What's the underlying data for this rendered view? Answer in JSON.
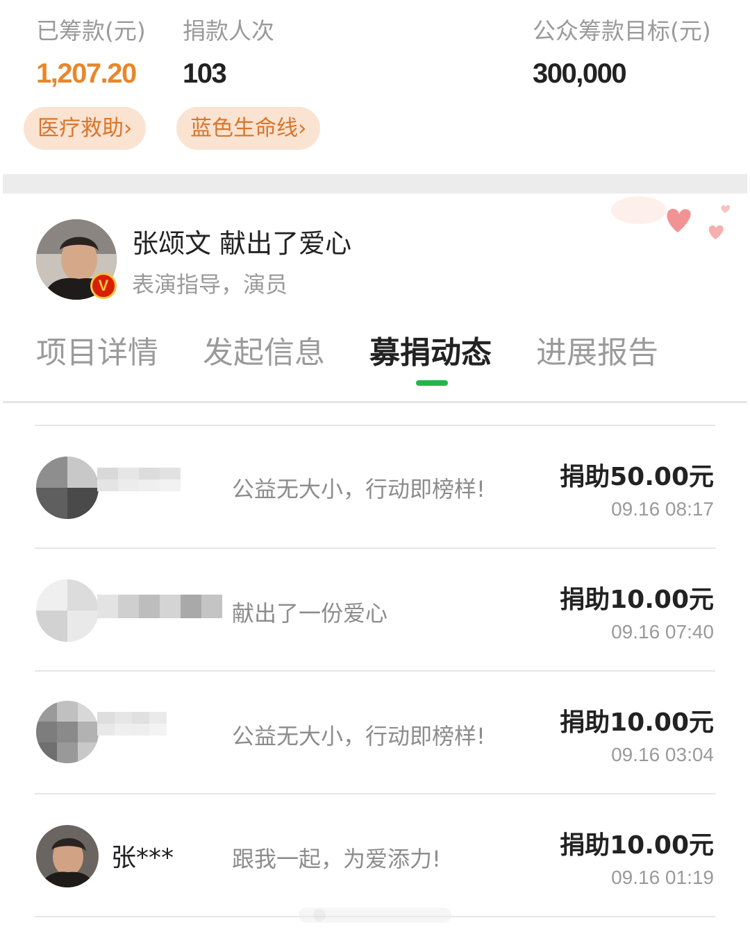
{
  "stats": {
    "raised_label": "已筹款(元)",
    "raised_value": "1,207.20",
    "donations_label": "捐款人次",
    "donations_value": "103",
    "goal_label": "公众筹款目标(元)",
    "goal_value": "300,000"
  },
  "tags": [
    {
      "label": "医疗救助›"
    },
    {
      "label": "蓝色生命线›"
    }
  ],
  "featured_donor": {
    "title": "张颂文 献出了爱心",
    "subtitle": "表演指导，演员",
    "badge": "V"
  },
  "tabs": [
    {
      "label": "项目详情"
    },
    {
      "label": "发起信息"
    },
    {
      "label": "募捐动态"
    },
    {
      "label": "进展报告"
    }
  ],
  "active_tab": "募捐动态",
  "donations": [
    {
      "name": "",
      "message": "公益无大小，行动即榜样!",
      "amount": "捐助50.00元",
      "time": "09.16 08:17"
    },
    {
      "name": "",
      "message": "献出了一份爱心",
      "amount": "捐助10.00元",
      "time": "09.16 07:40"
    },
    {
      "name": "",
      "message": "公益无大小，行动即榜样!",
      "amount": "捐助10.00元",
      "time": "09.16 03:04"
    },
    {
      "name": "张***",
      "message": "跟我一起，为爱添力!",
      "amount": "捐助10.00元",
      "time": "09.16 01:19"
    }
  ],
  "colors": {
    "accent_orange": "#e8872a",
    "tag_bg": "#fbe3d2",
    "active_indicator": "#28b34a",
    "badge_red": "#d81e06"
  }
}
